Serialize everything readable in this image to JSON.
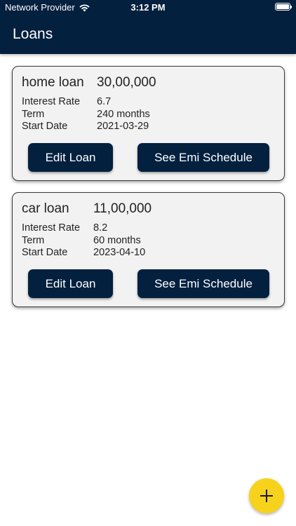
{
  "status_bar": {
    "carrier": "Network Provider",
    "time": "3:12 PM"
  },
  "app_bar": {
    "title": "Loans"
  },
  "loans": [
    {
      "name": "home loan",
      "amount": "30,00,000",
      "interest_rate_label": "Interest Rate",
      "interest_rate": "6.7",
      "term_label": "Term",
      "term": "240 months",
      "start_date_label": "Start Date",
      "start_date": "2021-03-29",
      "edit_label": "Edit Loan",
      "emi_label": "See Emi Schedule"
    },
    {
      "name": "car loan",
      "amount": "11,00,000",
      "interest_rate_label": "Interest Rate",
      "interest_rate": "8.2",
      "term_label": "Term",
      "term": "60 months",
      "start_date_label": "Start Date",
      "start_date": "2023-04-10",
      "edit_label": "Edit Loan",
      "emi_label": "See Emi Schedule"
    }
  ],
  "fab": {
    "icon": "plus-icon"
  },
  "colors": {
    "primary": "#03203f",
    "fab": "#f7d21c",
    "card_background": "#f2f2f2"
  }
}
